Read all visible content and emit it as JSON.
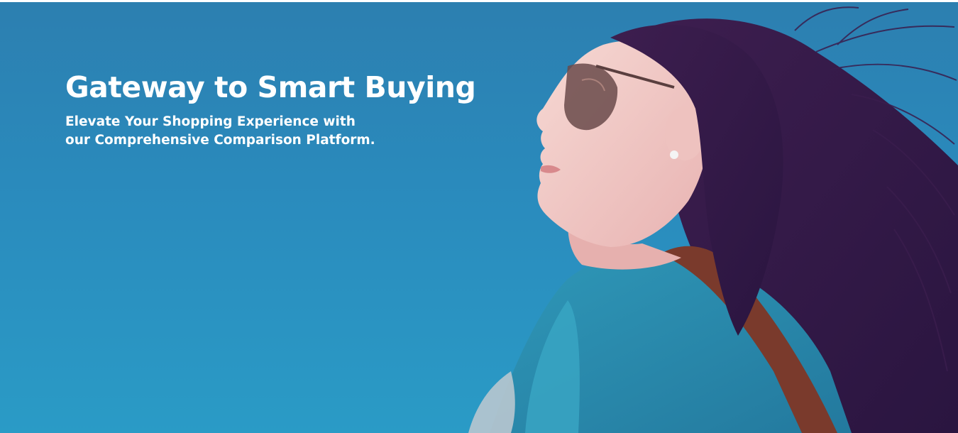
{
  "hero": {
    "title": "Gateway to Smart Buying",
    "subtitle": "Elevate Your Shopping Experience with our Comprehensive Comparison Platform.",
    "image": "woman-with-sunglasses-photo",
    "colors": {
      "sky_top": "#2c7fb0",
      "sky_bottom": "#2a9bc6",
      "text": "#ffffff",
      "hair": "#3a1f4e",
      "skin": "#f2cbc6",
      "jacket": "#2b8fb0",
      "strap": "#7a3a2c"
    }
  }
}
